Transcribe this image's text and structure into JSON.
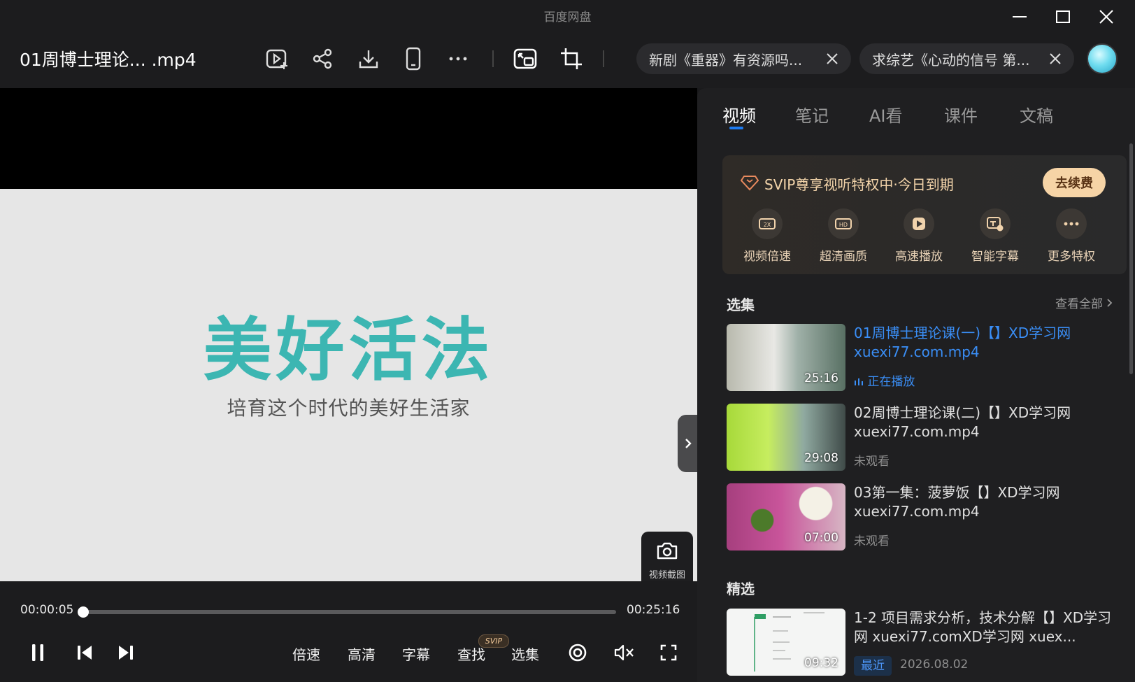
{
  "app": {
    "title": "百度网盘"
  },
  "toolbar": {
    "file_title": "01周博士理论...   .mp4",
    "tabs": [
      {
        "label": "新剧《重器》有资源吗..."
      },
      {
        "label": "求综艺《心动的信号 第..."
      }
    ]
  },
  "player": {
    "video_title": "美好活法",
    "video_subtitle": "培育这个时代的美好生活家",
    "current_time": "00:00:05",
    "total_time": "00:25:16",
    "progress": 0.0033,
    "snapshot_label": "视频截图",
    "controls": {
      "speed": "倍速",
      "quality": "高清",
      "subtitle": "字幕",
      "find": "查找",
      "find_badge": "SVIP",
      "episodes": "选集"
    }
  },
  "panel": {
    "tabs": [
      "视频",
      "笔记",
      "AI看",
      "课件",
      "文稿"
    ],
    "active_tab": 0,
    "svip": {
      "title": "SVIP尊享视听特权中·今日到期",
      "renew_label": "去续费",
      "perks": [
        "视频倍速",
        "超清画质",
        "高速播放",
        "智能字幕",
        "更多特权"
      ]
    },
    "episodes_section": {
      "title": "选集",
      "see_all": "查看全部",
      "items": [
        {
          "title": "01周博士理论课(一)【】XD学习网 xuexi77.com.mp4",
          "duration": "25:16",
          "status": "正在播放",
          "playing": true
        },
        {
          "title": "02周博士理论课(二)【】XD学习网 xuexi77.com.mp4",
          "duration": "29:08",
          "status": "未观看",
          "playing": false
        },
        {
          "title": "03第一集：菠萝饭【】XD学习网 xuexi77.com.mp4",
          "duration": "07:00",
          "status": "未观看",
          "playing": false
        }
      ]
    },
    "featured_section": {
      "title": "精选",
      "items": [
        {
          "title": "1-2 项目需求分析，技术分解【】XD学习网 xuexi77.comXD学习网 xuex...",
          "duration": "09:32",
          "tag": "最近",
          "date": "2026.08.02"
        }
      ]
    }
  },
  "colors": {
    "accent": "#1e7cf2",
    "logo_teal": "#3cb6b2",
    "svip_gold": "#f6d4a6",
    "background": "#1c1c1e"
  }
}
